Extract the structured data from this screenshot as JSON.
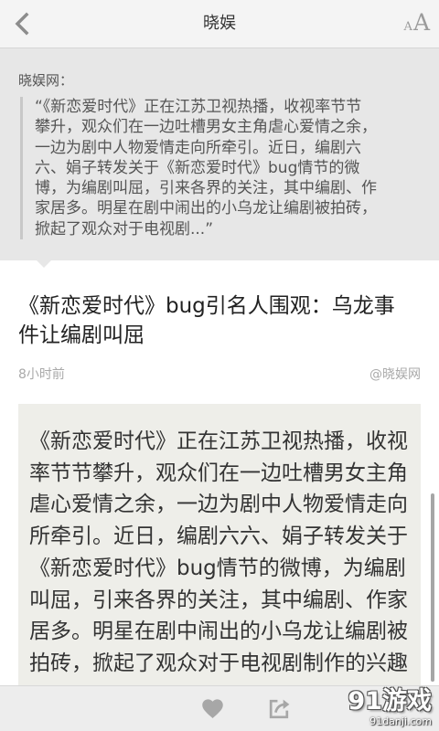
{
  "header": {
    "title": "晓娱",
    "back_icon": "chevron-left-icon",
    "font_size_icon": "font-size-icon",
    "font_size_small": "A",
    "font_size_large": "A"
  },
  "quote": {
    "source": "晓娱网：",
    "lines": [
      "“《新恋爱时代》正在江苏卫视热播，收视率节节",
      "攀升，观众们在一边吐槽男女主角虐心爱情之余，",
      "一边为剧中人物爱情走向所牵引。近日，编剧六",
      "六、娟子转发关于《新恋爱时代》bug情节的微",
      "博，为编剧叫屈，引来各界的关注，其中编剧、作",
      "家居多。明星在剧中闹出的小乌龙让编剧被拍砖，",
      "掀起了观众对于电视剧...”"
    ]
  },
  "article": {
    "title_lines": [
      "《新恋爱时代》bug引名人围观：乌龙事",
      "件让编剧叫屈"
    ],
    "time": "8小时前",
    "source": "@晓娱网",
    "body_lines": [
      "《新恋爱时代》正在江苏卫视热播，收视",
      "率节节攀升，观众们在一边吐槽男女主角",
      "虐心爱情之余，一边为剧中人物爱情走向",
      "所牵引。近日，编剧六六、娟子转发关于",
      "《新恋爱时代》bug情节的微博，为编剧",
      "叫屈，引来各界的关注，其中编剧、作家",
      "居多。明星在剧中闹出的小乌龙让编剧被",
      "拍砖，掀起了观众对于电视剧制作的兴趣"
    ]
  },
  "footer": {
    "like_icon": "heart-icon",
    "share_icon": "share-icon"
  },
  "watermark": {
    "logo": "91游戏",
    "site": "91danji.com"
  },
  "colors": {
    "header_bg": "#f4f4f4",
    "quote_bg": "#e7e7e7",
    "body_bg": "#eeeee9",
    "text": "#333333",
    "muted": "#a9a9a9"
  }
}
